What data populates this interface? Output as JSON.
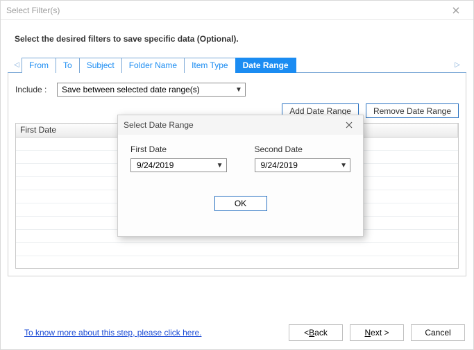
{
  "window": {
    "title": "Select Filter(s)"
  },
  "instruction": "Select the desired filters to save specific data (Optional).",
  "tabs": [
    {
      "label": "From"
    },
    {
      "label": "To"
    },
    {
      "label": "Subject"
    },
    {
      "label": "Folder Name"
    },
    {
      "label": "Item Type"
    },
    {
      "label": "Date Range"
    }
  ],
  "active_tab_index": 5,
  "include": {
    "label": "Include :",
    "value": "Save between selected date range(s)"
  },
  "buttons": {
    "add": "Add Date Range",
    "remove": "Remove Date Range"
  },
  "grid": {
    "columns": [
      {
        "label": "First Date"
      },
      {
        "label": ""
      }
    ]
  },
  "help_link": "To know more about this step, please click here.",
  "wizard": {
    "back_prefix": "< ",
    "back_key": "B",
    "back_rest": "ack",
    "next_key": "N",
    "next_rest": "ext >",
    "cancel": "Cancel"
  },
  "modal": {
    "title": "Select Date Range",
    "first_label": "First Date",
    "second_label": "Second Date",
    "first_value": "9/24/2019",
    "second_value": "9/24/2019",
    "ok": "OK"
  }
}
